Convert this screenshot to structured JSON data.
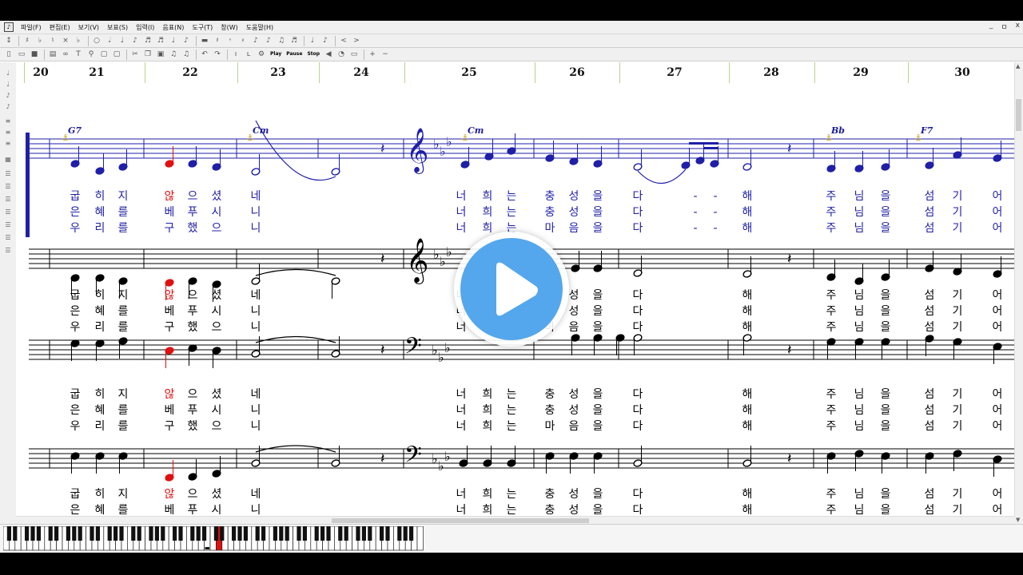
{
  "menu": [
    "파일(F)",
    "편집(E)",
    "보기(V)",
    "보표(S)",
    "입력(I)",
    "음표(N)",
    "도구(T)",
    "창(W)",
    "도움말(H)"
  ],
  "window_controls": [
    "_",
    "ㅁ",
    "x"
  ],
  "toolbar_icons_1": [
    "toggle-icon",
    "sharp-icon",
    "flat-icon",
    "natural-icon",
    "double-sharp-icon",
    "double-flat-icon",
    "whole-note-icon",
    "half-note-icon",
    "quarter-note-icon",
    "eighth-note-icon",
    "sixteenth-note-icon",
    "thirtysecond-note-icon",
    "half-rest-icon",
    "quarter-rest-icon",
    "eighth-rest-icon",
    "sixteenth-rest-icon",
    "tie-icon",
    "beam-icon",
    "crescendo-icon",
    "decrescendo-icon"
  ],
  "toolbar_icons_2": [
    "new-file-icon",
    "open-folder-icon",
    "save-icon",
    "print-icon",
    "glasses-icon",
    "text-icon",
    "zoom-icon",
    "cut-icon",
    "copy-icon",
    "paste-icon",
    "undo-icon",
    "redo-icon",
    "lyric-icon",
    "chord-icon",
    "midi-icon",
    "add-icon",
    "remove-icon"
  ],
  "transport": {
    "play": "Play",
    "pause": "Pause",
    "stop": "Stop"
  },
  "measures": [
    "20",
    "21",
    "22",
    "23",
    "24",
    "25",
    "26",
    "27",
    "28",
    "29",
    "30"
  ],
  "chords": [
    "G7",
    "Cm",
    "Cm",
    "Bb",
    "F7"
  ],
  "staff1_lyrics": [
    [
      "굽",
      "히",
      "지",
      "않",
      "으",
      "셨",
      "네",
      "너",
      "희",
      "는",
      "충",
      "성",
      "을",
      "다",
      "-",
      "-",
      "해",
      "주",
      "님",
      "을",
      "섬",
      "기",
      "어"
    ],
    [
      "은",
      "혜",
      "를",
      "베",
      "푸",
      "시",
      "니",
      "너",
      "희",
      "는",
      "충",
      "성",
      "을",
      "다",
      "-",
      "-",
      "해",
      "주",
      "님",
      "을",
      "섬",
      "기",
      "어"
    ],
    [
      "우",
      "리",
      "를",
      "구",
      "했",
      "으",
      "니",
      "너",
      "희",
      "는",
      "마",
      "음",
      "을",
      "다",
      "-",
      "-",
      "해",
      "주",
      "님",
      "을",
      "섬",
      "기",
      "어"
    ]
  ],
  "staff_lyrics": [
    [
      "굽",
      "히",
      "지",
      "않",
      "으",
      "셨",
      "네",
      "너",
      "희",
      "는",
      "충",
      "성",
      "을",
      "다",
      "해",
      "주",
      "님",
      "을",
      "섬",
      "기",
      "어"
    ],
    [
      "은",
      "혜",
      "를",
      "베",
      "푸",
      "시",
      "니",
      "너",
      "희",
      "는",
      "충",
      "성",
      "을",
      "다",
      "해",
      "주",
      "님",
      "을",
      "섬",
      "기",
      "어"
    ],
    [
      "우",
      "리",
      "를",
      "구",
      "했",
      "으",
      "니",
      "너",
      "희",
      "는",
      "마",
      "음",
      "을",
      "다",
      "해",
      "주",
      "님",
      "을",
      "섬",
      "기",
      "어"
    ]
  ],
  "colors": {
    "accent": "#1f1fa8",
    "highlight": "#e01010",
    "selection_bar": "#1f1fa8",
    "play_button": "#54a7ec",
    "ruler_tick": "#b9d48c"
  }
}
